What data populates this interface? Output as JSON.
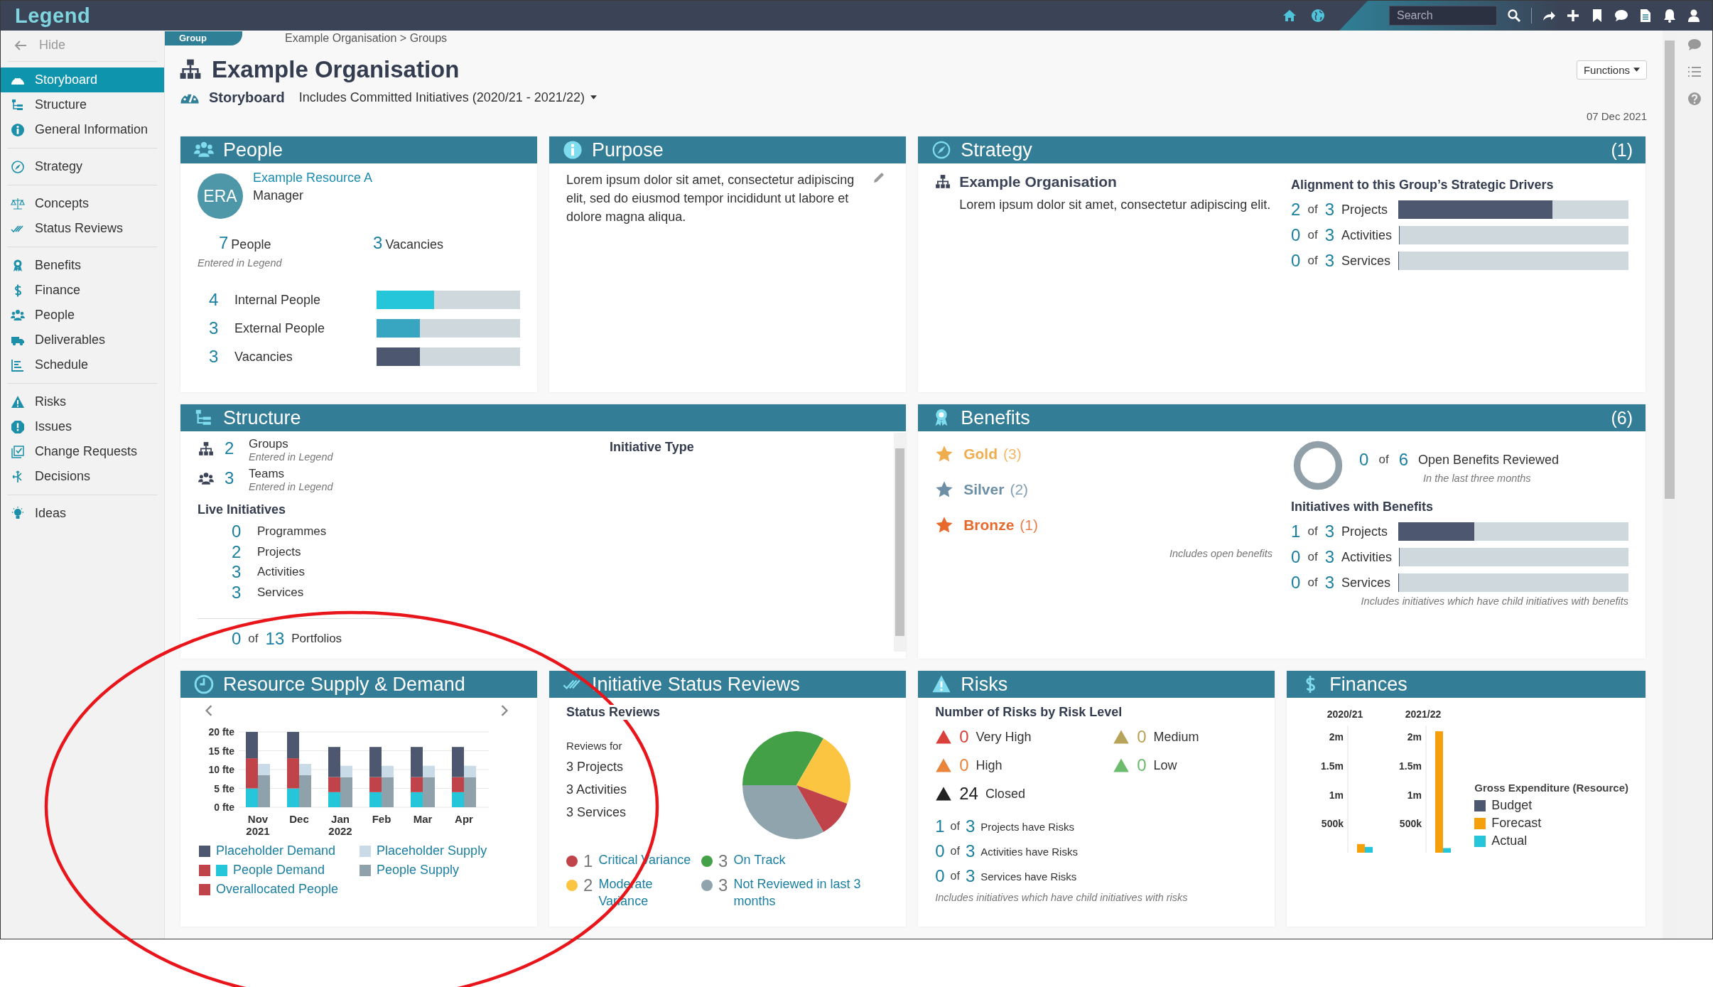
{
  "app": {
    "logo": "Legend",
    "search": {
      "placeholder": "Search"
    }
  },
  "sidebar": {
    "hide_label": "Hide",
    "groups": [
      {
        "items": [
          {
            "label": "Storyboard",
            "selected": true
          },
          {
            "label": "Structure",
            "selected": false
          },
          {
            "label": "General Information",
            "selected": false
          }
        ]
      },
      {
        "items": [
          {
            "label": "Strategy",
            "selected": false
          }
        ]
      },
      {
        "items": [
          {
            "label": "Concepts",
            "selected": false
          },
          {
            "label": "Status Reviews",
            "selected": false
          }
        ]
      },
      {
        "items": [
          {
            "label": "Benefits",
            "selected": false
          },
          {
            "label": "Finance",
            "selected": false
          },
          {
            "label": "People",
            "selected": false
          },
          {
            "label": "Deliverables",
            "selected": false
          },
          {
            "label": "Schedule",
            "selected": false
          }
        ]
      },
      {
        "items": [
          {
            "label": "Risks",
            "selected": false
          },
          {
            "label": "Issues",
            "selected": false
          },
          {
            "label": "Change Requests",
            "selected": false
          },
          {
            "label": "Decisions",
            "selected": false
          }
        ]
      },
      {
        "items": [
          {
            "label": "Ideas",
            "selected": false
          }
        ]
      }
    ]
  },
  "breadcrumb": {
    "tab": "Group",
    "path": "Example Organisation > Groups"
  },
  "header": {
    "title": "Example Organisation",
    "view": "Storyboard",
    "filter": "Includes Committed Initiatives (2020/21 - 2021/22)",
    "functions_button": "Functions",
    "date": "07 Dec 2021"
  },
  "people": {
    "title": "People",
    "manager": {
      "initials": "ERA",
      "name": "Example Resource A",
      "role": "Manager"
    },
    "totals": [
      {
        "value": "7",
        "label": "People",
        "note": "Entered in Legend"
      },
      {
        "value": "3",
        "label": "Vacancies"
      }
    ],
    "bars": [
      {
        "value": "4",
        "label": "Internal People",
        "level": 0.4,
        "color": "#26c6da"
      },
      {
        "value": "3",
        "label": "External People",
        "level": 0.3,
        "color": "#39a6c1"
      },
      {
        "value": "3",
        "label": "Vacancies",
        "level": 0.3,
        "color": "#4e5770"
      }
    ]
  },
  "purpose": {
    "title": "Purpose",
    "text": "Lorem ipsum dolor sit amet, consectetur adipiscing elit, sed do eiusmod tempor incididunt ut labore et dolore magna aliqua."
  },
  "strategy": {
    "title": "Strategy",
    "count": "(1)",
    "organisation": "Example Organisation",
    "text": "Lorem ipsum dolor sit amet, consectetur adipiscing elit.",
    "alignment_title": "Alignment to this Group’s Strategic Drivers",
    "rows": [
      {
        "value": "2",
        "of": "of",
        "total": "3",
        "label": "Projects",
        "level": 0.67
      },
      {
        "value": "0",
        "of": "of",
        "total": "3",
        "label": "Activities",
        "level": 0
      },
      {
        "value": "0",
        "of": "of",
        "total": "3",
        "label": "Services",
        "level": 0
      }
    ]
  },
  "structure": {
    "title": "Structure",
    "counts": [
      {
        "value": "2",
        "label": "Groups",
        "note": "Entered in Legend"
      },
      {
        "value": "3",
        "label": "Teams",
        "note": "Entered in Legend"
      }
    ],
    "live_title": "Live Initiatives",
    "live": [
      {
        "value": "0",
        "label": "Programmes"
      },
      {
        "value": "2",
        "label": "Projects"
      },
      {
        "value": "3",
        "label": "Activities"
      },
      {
        "value": "3",
        "label": "Services"
      }
    ],
    "portfolios": {
      "value": "0",
      "of": "of",
      "total": "13",
      "label": "Portfolios"
    },
    "initiative_type_title": "Initiative Type"
  },
  "benefits": {
    "title": "Benefits",
    "count": "(6)",
    "tiers": [
      {
        "label": "Gold",
        "count": "(3)",
        "color": "#f0ad4e"
      },
      {
        "label": "Silver",
        "count": "(2)",
        "color": "#6d8fa5"
      },
      {
        "label": "Bronze",
        "count": "(1)",
        "color": "#e8692c"
      }
    ],
    "open_note": "Includes open benefits",
    "reviewed": {
      "value": "0",
      "of": "of",
      "total": "6",
      "label": "Open Benefits Reviewed",
      "note": "In the last three months"
    },
    "initiatives_title": "Initiatives with Benefits",
    "rows": [
      {
        "value": "1",
        "of": "of",
        "total": "3",
        "label": "Projects",
        "level": 0.33
      },
      {
        "value": "0",
        "of": "of",
        "total": "3",
        "label": "Activities",
        "level": 0
      },
      {
        "value": "0",
        "of": "of",
        "total": "3",
        "label": "Services",
        "level": 0
      }
    ],
    "note": "Includes initiatives which have child initiatives with benefits"
  },
  "resource": {
    "title": "Resource Supply & Demand",
    "demand": {
      "chart_data": {
        "type": "bar",
        "stacked": true,
        "grid": true,
        "categories": [
          "Nov 2021",
          "Dec",
          "Jan 2022",
          "Feb",
          "Mar",
          "Apr"
        ],
        "series": [
          {
            "name": "People Demand",
            "color": "#26c6da",
            "values": [
              5,
              5,
              4,
              4,
              4,
              4
            ]
          },
          {
            "name": "Overallocated People",
            "color": "#c0434a",
            "values": [
              8,
              8,
              4,
              4,
              4,
              4
            ]
          },
          {
            "name": "Placeholder Demand",
            "color": "#4e5770",
            "values": [
              7,
              7,
              8,
              8,
              8,
              8
            ]
          }
        ],
        "ylim": [
          0,
          20
        ],
        "yticks": [
          {
            "value": 0,
            "label": "0 fte"
          },
          {
            "value": 5,
            "label": "5 fte"
          },
          {
            "value": 10,
            "label": "10 fte"
          },
          {
            "value": 15,
            "label": "15 fte"
          },
          {
            "value": 20,
            "label": "20 fte"
          }
        ]
      }
    },
    "supply": {
      "chart_data": {
        "type": "bar",
        "stacked": true,
        "series": [
          {
            "name": "People Supply",
            "color": "#8fa1ab",
            "values": [
              8.5,
              8.5,
              8,
              8,
              8,
              8
            ]
          },
          {
            "name": "Placeholder Supply",
            "color": "#c9dbe6",
            "values": [
              3,
              3,
              3,
              3,
              3,
              3
            ]
          }
        ],
        "ylim": [
          0,
          20
        ]
      }
    }
  },
  "status_reviews": {
    "title": "Initiative Status Reviews",
    "heading": "Status Reviews",
    "reviews_for": "Reviews for",
    "items": [
      "3 Projects",
      "3 Activities",
      "3 Services"
    ],
    "chart_data": {
      "type": "pie",
      "categories": [
        "On Track",
        "Moderate Variance",
        "Critical Variance",
        "Not Reviewed in last 3 months"
      ],
      "values": [
        3,
        2,
        1,
        3
      ]
    },
    "legend": [
      {
        "value": "1",
        "color": "#c0434a"
      },
      {
        "value": "3",
        "color": "#43a047"
      },
      {
        "value": "2",
        "color": "#fbc541"
      },
      {
        "value": "3",
        "color": "#90a4ae"
      }
    ]
  },
  "risks": {
    "title": "Risks",
    "heading": "Number of Risks by Risk Level",
    "levels": [
      {
        "value": "0",
        "label": "Very High",
        "color": "#d9413a"
      },
      {
        "value": "0",
        "label": "Medium",
        "color": "#b8a35a"
      },
      {
        "value": "0",
        "label": "High",
        "color": "#e8843c"
      },
      {
        "value": "0",
        "label": "Low",
        "color": "#6dbb6d"
      },
      {
        "value": "24",
        "label": "Closed",
        "color": "#222222"
      }
    ],
    "rows": [
      {
        "value": "1",
        "of": "of",
        "total": "3",
        "label": "Projects have Risks"
      },
      {
        "value": "0",
        "of": "of",
        "total": "3",
        "label": "Activities have Risks"
      },
      {
        "value": "0",
        "of": "of",
        "total": "3",
        "label": "Services have Risks"
      }
    ],
    "note": "Includes initiatives which have child initiatives with risks"
  },
  "finances": {
    "title": "Finances",
    "legend_title": "Gross Expenditure (Resource)",
    "chart_data": {
      "type": "bar",
      "stacked": false,
      "ylim": [
        0,
        2200000
      ],
      "categories": [
        "2020/21",
        "2021/22"
      ],
      "series": [
        {
          "name": "Budget",
          "color": "#4e5770",
          "values": [
            0,
            0
          ]
        },
        {
          "name": "Forecast",
          "color": "#f5a00a",
          "values": [
            150000,
            2100000
          ]
        },
        {
          "name": "Actual",
          "color": "#26c6da",
          "values": [
            100000,
            80000
          ]
        }
      ],
      "yticks": [
        {
          "value": 500000,
          "label": "500k"
        },
        {
          "value": 1000000,
          "label": "1m"
        },
        {
          "value": 1500000,
          "label": "1.5m"
        },
        {
          "value": 2000000,
          "label": "2m"
        }
      ]
    }
  }
}
